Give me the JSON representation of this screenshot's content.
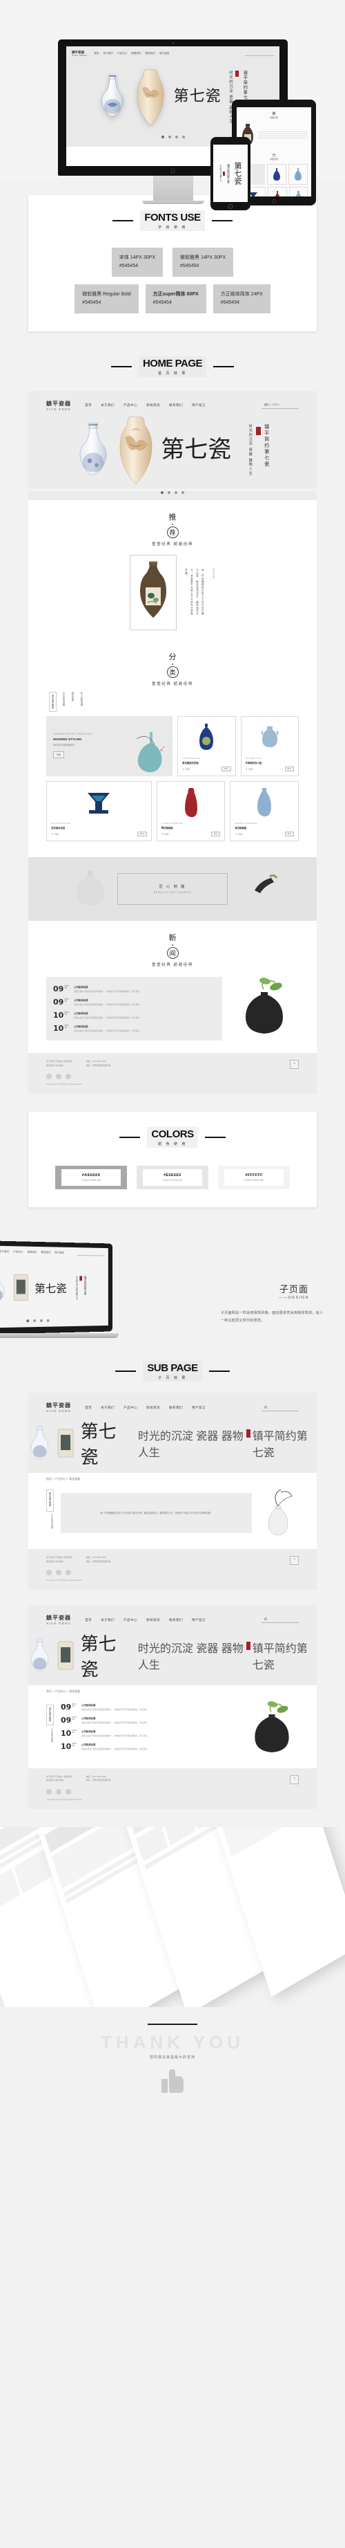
{
  "meta": {
    "title": "第七瓷 — 镇平瓷器网站设计展示"
  },
  "brand": {
    "cn": "鎮平瓷器",
    "en": "XIAO GENG"
  },
  "nav": {
    "items": [
      "首页",
      "关于我们",
      "产品中心",
      "新闻资讯",
      "联系我们",
      "用户留言"
    ],
    "search_placeholder": "请输入关键词",
    "search_icon": "search-icon"
  },
  "hero": {
    "title": "第七瓷",
    "vertical_title": "镇平简约第七瓷",
    "vertical_text": "时光的沉淀\n瓷器\n器物人生",
    "dots": 4
  },
  "sections": {
    "fonts": {
      "en": "FONTS USE",
      "cn": "字 体 使 用",
      "chips": [
        {
          "line1": "宋体    14PX  30PX",
          "line2": "#545454",
          "bold": false
        },
        {
          "line1": "微软雅黑  14PX 30PX",
          "line2": "#545454",
          "bold": false
        },
        {
          "line1": "微软雅黑  Regular Bold",
          "line2": "#545454",
          "bold": false
        },
        {
          "line1": "方正super简体 60PX",
          "line2": "#545454",
          "bold": true
        },
        {
          "line1": "方正姚体简体  24PX",
          "line2": "#545454",
          "bold": false
        }
      ]
    },
    "home": {
      "en": "HOME PAGE",
      "cn": "首 页 效 果"
    },
    "colors": {
      "en": "COLORS",
      "cn": "颜 色 使 用",
      "swatches": [
        {
          "hex": "#A8A8A8",
          "rgb": "R:168 G:168 B:168",
          "bg": "#A8A8A8"
        },
        {
          "hex": "#E6E6E6",
          "rgb": "R:230 G:230 B:230",
          "bg": "#E6E6E6"
        },
        {
          "hex": "#FFFFFF",
          "rgb": "R:255 G:255 B:255",
          "bg": "#FFFFFF"
        }
      ]
    },
    "sub": {
      "en": "SUB PAGE",
      "cn": "子 页 效 果"
    }
  },
  "recommend": {
    "char1": "推",
    "char2": "荐",
    "sub": "重塑经典  超越经典",
    "vertical_desc": "每一件瓷器都经过匠人千百次的打磨与淬炼，釉色温润如玉，器型端庄大方，承载着千年窑火不灭的东方审美意趣。",
    "side_note": "匠心之作"
  },
  "category": {
    "char1": "分",
    "char2": "类",
    "sub": "重塑经典  超越经典",
    "tags": [
      "青花瓷古典瓷",
      "中式现代瓷器",
      "釉彩瓷器",
      "私人定制瓷器"
    ]
  },
  "products": {
    "feature": {
      "en_top": "CHINESE  RETRO  PORCELAIN",
      "title": "MODERN STYLING",
      "desc": "现代简约风格瓷器设计",
      "btn": "查看"
    },
    "items": [
      {
        "en": "LAN DIAN BAO HUA",
        "name": "青花缠枝纹赏瓶",
        "price": "￥ 1680",
        "buy": "BUY"
      },
      {
        "en": "TIAN QING YOU XI",
        "name": "天青釉双耳小瓶",
        "price": "￥ 1280",
        "buy": "BUY"
      },
      {
        "en": "WU CAI GAO ZU PAN",
        "name": "五彩高足供盘",
        "price": "￥ 2380",
        "buy": "BUY"
      },
      {
        "en": "JI HONG YOU MEI PING",
        "name": "霁红釉梅瓶",
        "price": "￥ 1980",
        "buy": "BUY"
      },
      {
        "en": "QING BAI YOU MEI PING",
        "name": "青白釉梅瓶",
        "price": "￥ 1580",
        "buy": "BUY"
      }
    ]
  },
  "banner": {
    "title": "匠 心 制 器",
    "sub": "REBUILD  THE  CLASSIC"
  },
  "news": {
    "char1": "新",
    "char2": "闻",
    "sub": "重塑经典  超越经典",
    "items": [
      {
        "day": "09",
        "year": "2017",
        "md": "15",
        "title": "公司新闻标题",
        "desc": "瓷器之美在于釉色与器型的和谐统一，传统技艺与现代审美相融合，历久弥新。"
      },
      {
        "day": "09",
        "year": "2017",
        "md": "18",
        "title": "公司新闻标题",
        "desc": "瓷器之美在于釉色与器型的和谐统一，传统技艺与现代审美相融合，历久弥新。"
      },
      {
        "day": "10",
        "year": "2017",
        "md": "10",
        "title": "公司新闻标题",
        "desc": "瓷器之美在于釉色与器型的和谐统一，传统技艺与现代审美相融合，历久弥新。"
      },
      {
        "day": "10",
        "year": "2017",
        "md": "18",
        "title": "公司新闻标题",
        "desc": "瓷器之美在于釉色与器型的和谐统一，传统技艺与现代审美相融合，历久弥新。"
      }
    ]
  },
  "footer": {
    "left": "关于我们    产品中心    新闻资讯\n联系我们    用户留言",
    "center": "电话：0377-000 0000\n地址：河南省南阳市镇平县",
    "copyright": "Copyright © 2017 第七瓷  All Rights Reserved",
    "top_icon": "chevron-up-icon",
    "social": [
      "weibo-icon",
      "wechat-icon",
      "qq-icon"
    ]
  },
  "subpage": {
    "cn": "子页面",
    "en": "——DESIGN",
    "desc": "子页面网站一样采用极简风格，面包屑依然采用姚体简体，给人一种古韵而又现代的感觉。",
    "crumb": "首页 > 产品中心 > 青花瓷器"
  },
  "thanks": {
    "title": "THANK YOU",
    "sub": "您的建议就是最大的支持",
    "icon": "thumbs-up-icon"
  }
}
